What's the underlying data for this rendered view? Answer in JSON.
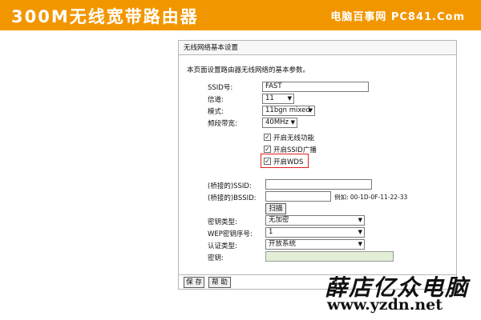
{
  "banner": {
    "title": "300M无线宽带路由器",
    "site": "电脑百事网 PC841.Com"
  },
  "panel": {
    "header": "无线网络基本设置",
    "description": "本页面设置路由器无线网络的基本参数。",
    "ssid": {
      "label": "SSID号:",
      "value": "FAST"
    },
    "channel": {
      "label": "信道:",
      "value": "11"
    },
    "mode": {
      "label": "模式:",
      "value": "11bgn mixed"
    },
    "bandwidth": {
      "label": "频段带宽:",
      "value": "40MHz"
    },
    "enable_wireless": {
      "label": "开启无线功能",
      "checked": true
    },
    "enable_ssid_broadcast": {
      "label": "开启SSID广播",
      "checked": true
    },
    "enable_wds": {
      "label": "开启WDS",
      "checked": true
    },
    "bridged_ssid": {
      "label": "(桥接的)SSID:",
      "value": ""
    },
    "bridged_bssid": {
      "label": "(桥接的)BSSID:",
      "value": "",
      "example": "例如: 00-1D-0F-11-22-33"
    },
    "scan_button": "扫描",
    "key_type": {
      "label": "密钥类型:",
      "value": "无加密"
    },
    "wep_index": {
      "label": "WEP密钥序号:",
      "value": "1"
    },
    "auth_type": {
      "label": "认证类型:",
      "value": "开放系统"
    },
    "key": {
      "label": "密钥:",
      "value": ""
    },
    "save_button": "保 存",
    "help_button": "帮 助"
  },
  "watermark": {
    "text_cn": "薛店亿众电脑",
    "url": "www.yzdn.net"
  },
  "colors": {
    "banner": "#f29600",
    "wds_highlight": "#e02020",
    "disabled_field": "#e3eed6"
  }
}
